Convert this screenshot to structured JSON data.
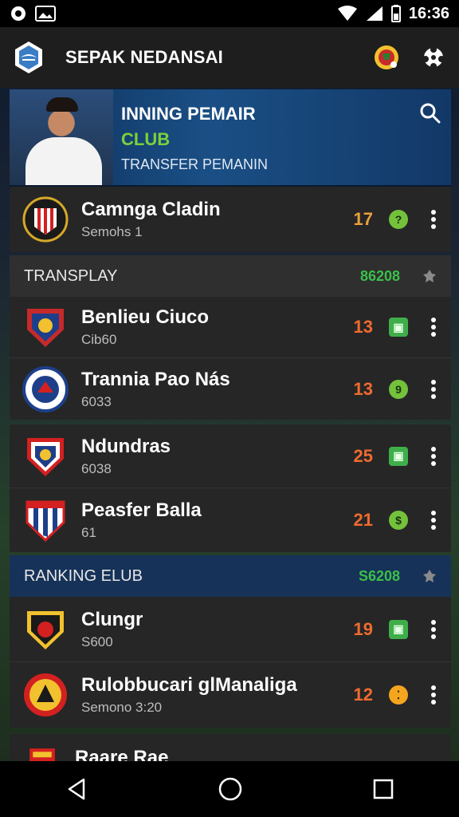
{
  "status_bar": {
    "time": "16:36"
  },
  "app": {
    "title": "SEPAK NEDANSAI"
  },
  "hero": {
    "title": "INNING PEMAIR",
    "club": "CLUB",
    "subtitle": "TRANSFER PEMANIN"
  },
  "top_row": {
    "name": "Camnga Cladin",
    "sub": "Semohs 1",
    "score": "17",
    "badge": "?"
  },
  "sections": [
    {
      "label": "TRANSPLAY",
      "value": "86208",
      "rows": [
        {
          "name": "Benlieu Ciuco",
          "sub": "Cib60",
          "score": "13",
          "badge": "▣"
        },
        {
          "name": "Trannia Pao Nás",
          "sub": "6033",
          "score": "13",
          "badge": "9"
        }
      ]
    },
    {
      "label": "",
      "value": "",
      "rows": [
        {
          "name": "Ndundras",
          "sub": "6038",
          "score": "25",
          "badge": "▣"
        },
        {
          "name": "Peasfer Balla",
          "sub": "61",
          "score": "21",
          "badge": "$"
        }
      ]
    },
    {
      "label": "RANKING ELUB",
      "value": "S6208",
      "rows": [
        {
          "name": "Clungr",
          "sub": "S600",
          "score": "19",
          "badge": "▣"
        },
        {
          "name": "Rulobbucari glManaliga",
          "sub": "Semono 3:20",
          "score": "12",
          "badge": "⁚"
        }
      ]
    }
  ],
  "partial_row": {
    "name": "Raare Rae"
  }
}
